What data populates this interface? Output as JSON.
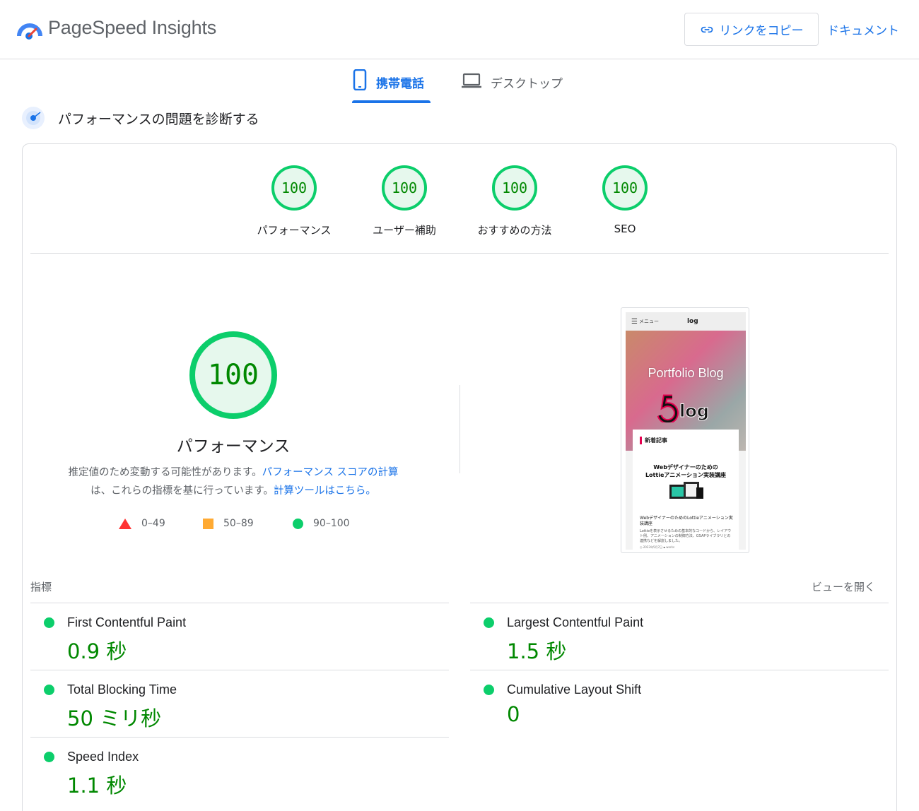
{
  "header": {
    "app_title": "PageSpeed Insights",
    "copy_link_label": "リンクをコピー",
    "docs_label": "ドキュメント"
  },
  "tabs": [
    {
      "label": "携帯電話",
      "icon": "smartphone-icon",
      "selected": true
    },
    {
      "label": "デスクトップ",
      "icon": "laptop-icon",
      "selected": false
    }
  ],
  "section": {
    "title": "パフォーマンスの問題を診断する"
  },
  "gauges": [
    {
      "score": "100",
      "label": "パフォーマンス"
    },
    {
      "score": "100",
      "label": "ユーザー補助"
    },
    {
      "score": "100",
      "label": "おすすめの方法"
    },
    {
      "score": "100",
      "label": "SEO"
    }
  ],
  "performance": {
    "score": "100",
    "label": "パフォーマンス",
    "desc_1": "推定値のため変動する可能性があります。",
    "desc_link_1": "パフォーマンス スコアの計算",
    "desc_2": "は、これらの指標を基に行っています。",
    "desc_link_2": "計算ツールはこちら。"
  },
  "legend": [
    {
      "range": "0–49",
      "shape": "triangle",
      "color": "#ff3333"
    },
    {
      "range": "50–89",
      "shape": "square",
      "color": "#ffaa33"
    },
    {
      "range": "90–100",
      "shape": "circle",
      "color": "#0cce6b"
    }
  ],
  "screenshot": {
    "menu_label": "メニュー",
    "hero_title": "Portfolio Blog",
    "logo_text": "log",
    "section_label": "新着記事",
    "headline_1": "Webデザイナーのための",
    "headline_2": "Lottieアニメーション実装講座",
    "post_title": "WebデザイナーのためのLottieアニメーション実装講座",
    "post_body": "Lottieを表示させるための基本的なコードから、レイアウト例、アニメーションの制御方法、GSAPライブラリとの連携などを解説しました。",
    "post_meta": "◷ 2023年5月7日  ▪ works"
  },
  "metrics": {
    "heading": "指標",
    "expand_label": "ビューを開く",
    "items": [
      {
        "name": "First Contentful Paint",
        "value": "0.9 秒"
      },
      {
        "name": "Largest Contentful Paint",
        "value": "1.5 秒"
      },
      {
        "name": "Total Blocking Time",
        "value": "50 ミリ秒"
      },
      {
        "name": "Cumulative Layout Shift",
        "value": "0"
      },
      {
        "name": "Speed Index",
        "value": "1.1 秒"
      }
    ]
  },
  "colors": {
    "accent": "#1a73e8",
    "pass": "#0cce6b",
    "pass_text": "#008800",
    "average": "#ffaa33",
    "fail": "#ff3333"
  }
}
